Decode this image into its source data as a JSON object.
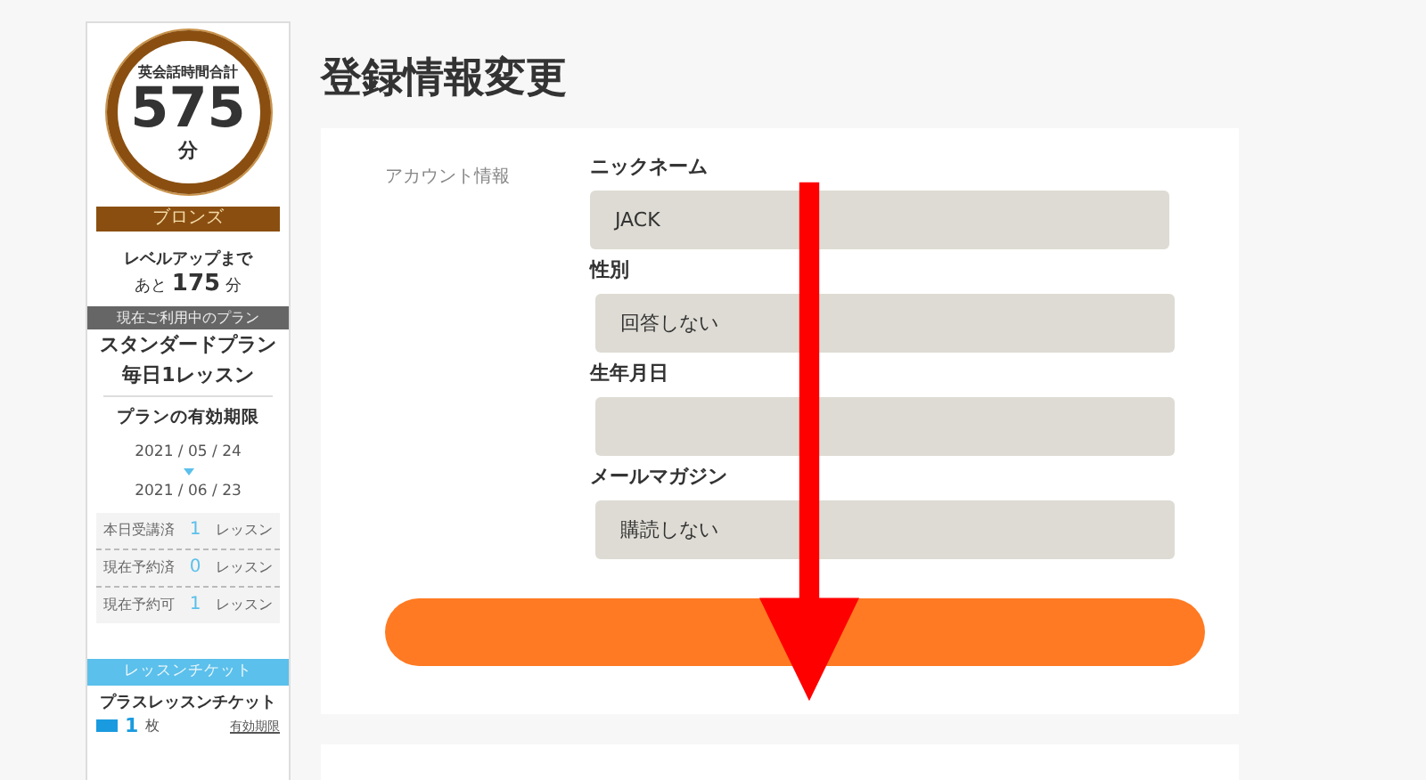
{
  "sidebar": {
    "total_label": "英会話時間合計",
    "total_value": "575",
    "total_unit": "分",
    "rank": "ブロンズ",
    "levelup_label": "レベルアップまで",
    "levelup_prefix": "あと",
    "levelup_value": "175",
    "levelup_unit": "分",
    "plan_heading": "現在ご利用中のプラン",
    "plan_name": "スタンダードプラン",
    "plan_detail": "毎日1レッスン",
    "validity_heading": "プランの有効期限",
    "start_date": "2021 / 05 / 24",
    "end_date": "2021 / 06 / 23",
    "stats": [
      {
        "label": "本日受講済",
        "value": "1",
        "unit": "レッスン"
      },
      {
        "label": "現在予約済",
        "value": "0",
        "unit": "レッスン"
      },
      {
        "label": "現在予約可",
        "value": "1",
        "unit": "レッスン"
      }
    ],
    "ticket_heading": "レッスンチケット",
    "ticket_name": "プラスレッスンチケット",
    "ticket_count": "1",
    "ticket_unit": "枚",
    "ticket_link": "有効期限"
  },
  "page_title": "登録情報変更",
  "form": {
    "section_label": "アカウント情報",
    "fields": [
      {
        "label": "ニックネーム",
        "value": "JACK"
      },
      {
        "label": "性別",
        "value": "回答しない"
      },
      {
        "label": "生年月日"
      },
      {
        "label": "メールマガジン",
        "value": "購読しない"
      }
    ]
  }
}
